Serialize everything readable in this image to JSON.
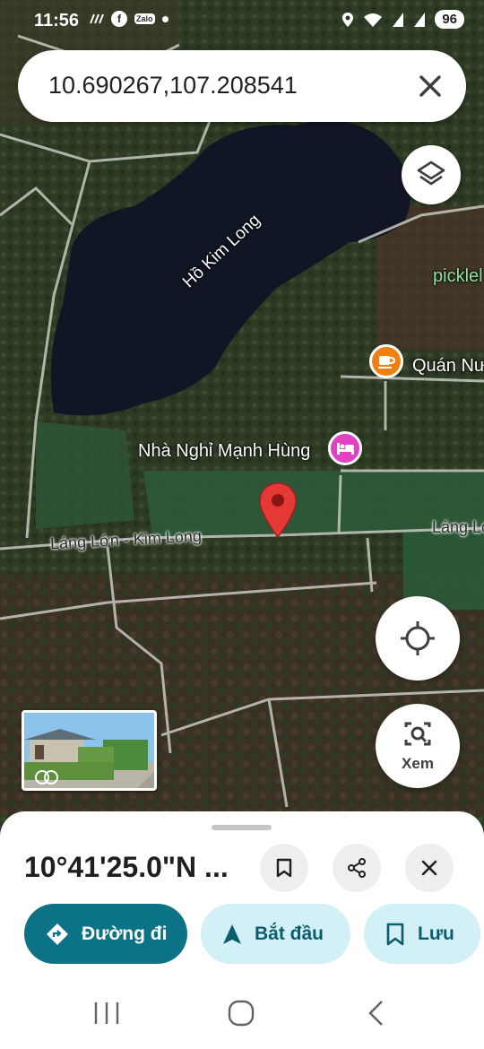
{
  "status_bar": {
    "time": "11:56",
    "battery": "96",
    "left_icons": [
      "activity-icon",
      "facebook-icon",
      "zalo-icon",
      "dot-icon"
    ],
    "zalo_text": "Zalo",
    "fb_text": "f",
    "right_icons": [
      "location-icon",
      "wifi-icon",
      "signal-icon",
      "signal-icon"
    ]
  },
  "search": {
    "query": "10.690267,107.208541"
  },
  "map": {
    "labels": {
      "lake": "Hồ Kim Long",
      "road_main": "Láng Lớn - Kim Long",
      "road_right": "Láng Lớ",
      "motel": "Nhà Nghỉ Mạnh Hùng",
      "cafe": "Quán Nư",
      "pickle": "picklel"
    },
    "view_button_label": "Xem",
    "layers_icon": "layers-icon",
    "locate_icon": "my-location-icon",
    "view_icon": "camera-search-icon"
  },
  "sheet": {
    "title": "10°41'25.0\"N ...",
    "actions": {
      "directions": "Đường đi",
      "start": "Bắt đầu",
      "save": "Lưu"
    }
  },
  "colors": {
    "accent": "#0b7385",
    "accent_light": "#d2f0f5",
    "pin": "#e53935",
    "cafe": "#f07f10",
    "motel": "#e042c2"
  }
}
